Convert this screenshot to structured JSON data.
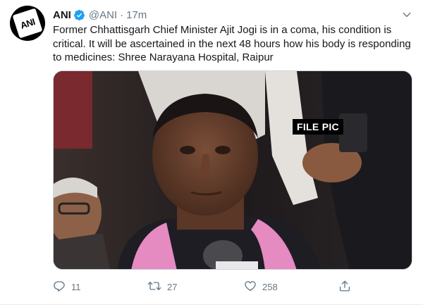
{
  "author": {
    "name": "ANI",
    "handle": "@ANI",
    "separator": "·",
    "time": "17m",
    "avatar_text": "ANI",
    "verified_color": "#1da1f2"
  },
  "tweet": {
    "text": "Former Chhattisgarh Chief Minister Ajit Jogi is in a coma, his condition is critical. It will be ascertained in the next 48 hours how his body is responding to medicines: Shree Narayana Hospital, Raipur"
  },
  "media": {
    "overlay_label": "FILE PIC"
  },
  "actions": {
    "reply_count": "11",
    "retweet_count": "27",
    "like_count": "258"
  },
  "icons": {
    "verified": "verified-badge-icon",
    "caret": "chevron-down-icon",
    "reply": "reply-icon",
    "retweet": "retweet-icon",
    "like": "heart-icon",
    "share": "share-icon"
  },
  "colors": {
    "text": "#14171a",
    "secondary": "#657786",
    "verified": "#1da1f2"
  }
}
